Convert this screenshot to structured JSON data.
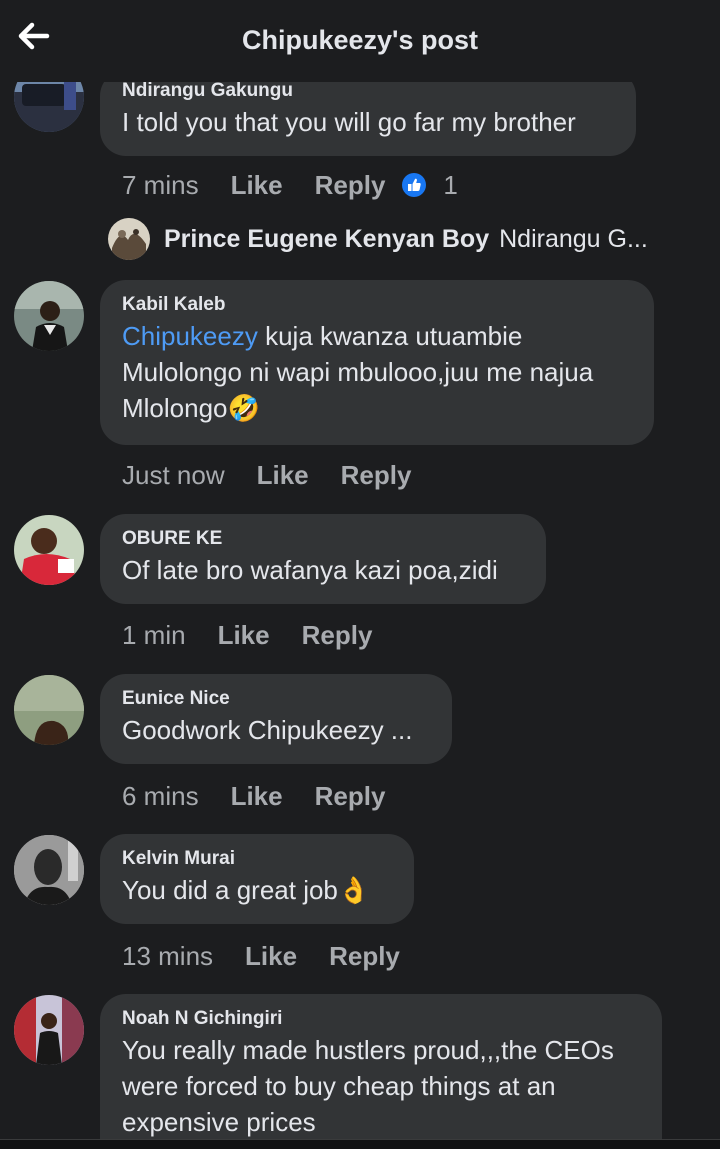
{
  "header": {
    "title": "Chipukeezy's post",
    "back_icon": "arrow-left-icon"
  },
  "comments": [
    {
      "author": "Ndirangu Gakungu",
      "text": "I told you that you will go far my brother",
      "time": "7 mins",
      "like_label": "Like",
      "reply_label": "Reply",
      "reaction_icon": "thumbs-up-icon",
      "reaction_count": "1",
      "reply_preview": {
        "author": "Prince Eugene Kenyan Boy",
        "snippet": "Ndirangu G..."
      }
    },
    {
      "author": "Kabil Kaleb",
      "mention": "Chipukeezy",
      "text_after_mention": " kuja kwanza utuambie",
      "line2": "Mulolongo ni wapi mbulooo,juu me najua",
      "line3": "Mlolongo",
      "emoji": "🤣",
      "time": "Just now",
      "like_label": "Like",
      "reply_label": "Reply"
    },
    {
      "author": "OBURE KE",
      "text": "Of late bro wafanya kazi poa,zidi",
      "time": "1 min",
      "like_label": "Like",
      "reply_label": "Reply"
    },
    {
      "author": "Eunice Nice",
      "text": "Goodwork Chipukeezy ...",
      "time": "6 mins",
      "like_label": "Like",
      "reply_label": "Reply"
    },
    {
      "author": "Kelvin Murai",
      "text": "You did a great job",
      "emoji": "👌",
      "time": "13 mins",
      "like_label": "Like",
      "reply_label": "Reply"
    },
    {
      "author": "Noah N Gichingiri",
      "line1": "You really made hustlers proud,,,the CEOs",
      "line2": "were forced to buy cheap things at an",
      "line3": "expensive prices"
    }
  ],
  "colors": {
    "background": "#1c1d1f",
    "bubble": "#323436",
    "mention": "#4e9bf5",
    "meta": "#a8abaf",
    "like_reaction": "#1877f2"
  }
}
